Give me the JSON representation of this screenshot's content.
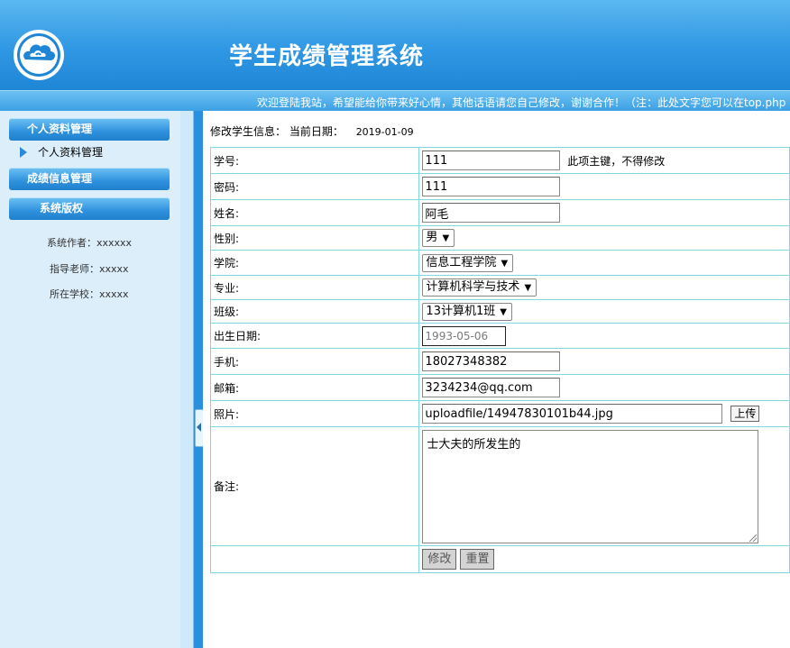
{
  "header": {
    "title": "学生成绩管理系统"
  },
  "marquee": {
    "text": "欢迎登陆我站，希望能给你带来好心情，其他话语请您自己修改，谢谢合作！（注：此处文字您可以在top.php"
  },
  "sidebar": {
    "menu1": "个人资料管理",
    "menu1_item": "个人资料管理",
    "menu2": "成绩信息管理",
    "menu3": "系统版权",
    "author": "系统作者：xxxxxx",
    "teacher": "指导老师：xxxxx",
    "school": "所在学校：xxxxx"
  },
  "page": {
    "heading": "修改学生信息：",
    "date_label": "当前日期：",
    "date": "2019-01-09"
  },
  "form": {
    "student_id": {
      "label": "学号:",
      "value": "111",
      "hint": "此项主键，不得修改"
    },
    "password": {
      "label": "密码:",
      "value": "111"
    },
    "name": {
      "label": "姓名:",
      "value": "阿毛"
    },
    "gender": {
      "label": "性别:",
      "value": "男"
    },
    "college": {
      "label": "学院:",
      "value": "信息工程学院"
    },
    "major": {
      "label": "专业:",
      "value": "计算机科学与技术"
    },
    "class": {
      "label": "班级:",
      "value": "13计算机1班"
    },
    "birthday": {
      "label": "出生日期:",
      "value": "1993-05-06"
    },
    "phone": {
      "label": "手机:",
      "value": "18027348382"
    },
    "email": {
      "label": "邮箱:",
      "value": "3234234@qq.com"
    },
    "photo": {
      "label": "照片:",
      "value": "uploadfile/14947830101b44.jpg",
      "upload_button": "上传"
    },
    "remark": {
      "label": "备注:",
      "value": "士大夫的所发生的"
    },
    "submit_button": "修改",
    "reset_button": "重置"
  },
  "colors": {
    "header_blue": "#2f97e3",
    "sidebar_bg": "#dceefa",
    "table_border": "#7fd9e5"
  }
}
